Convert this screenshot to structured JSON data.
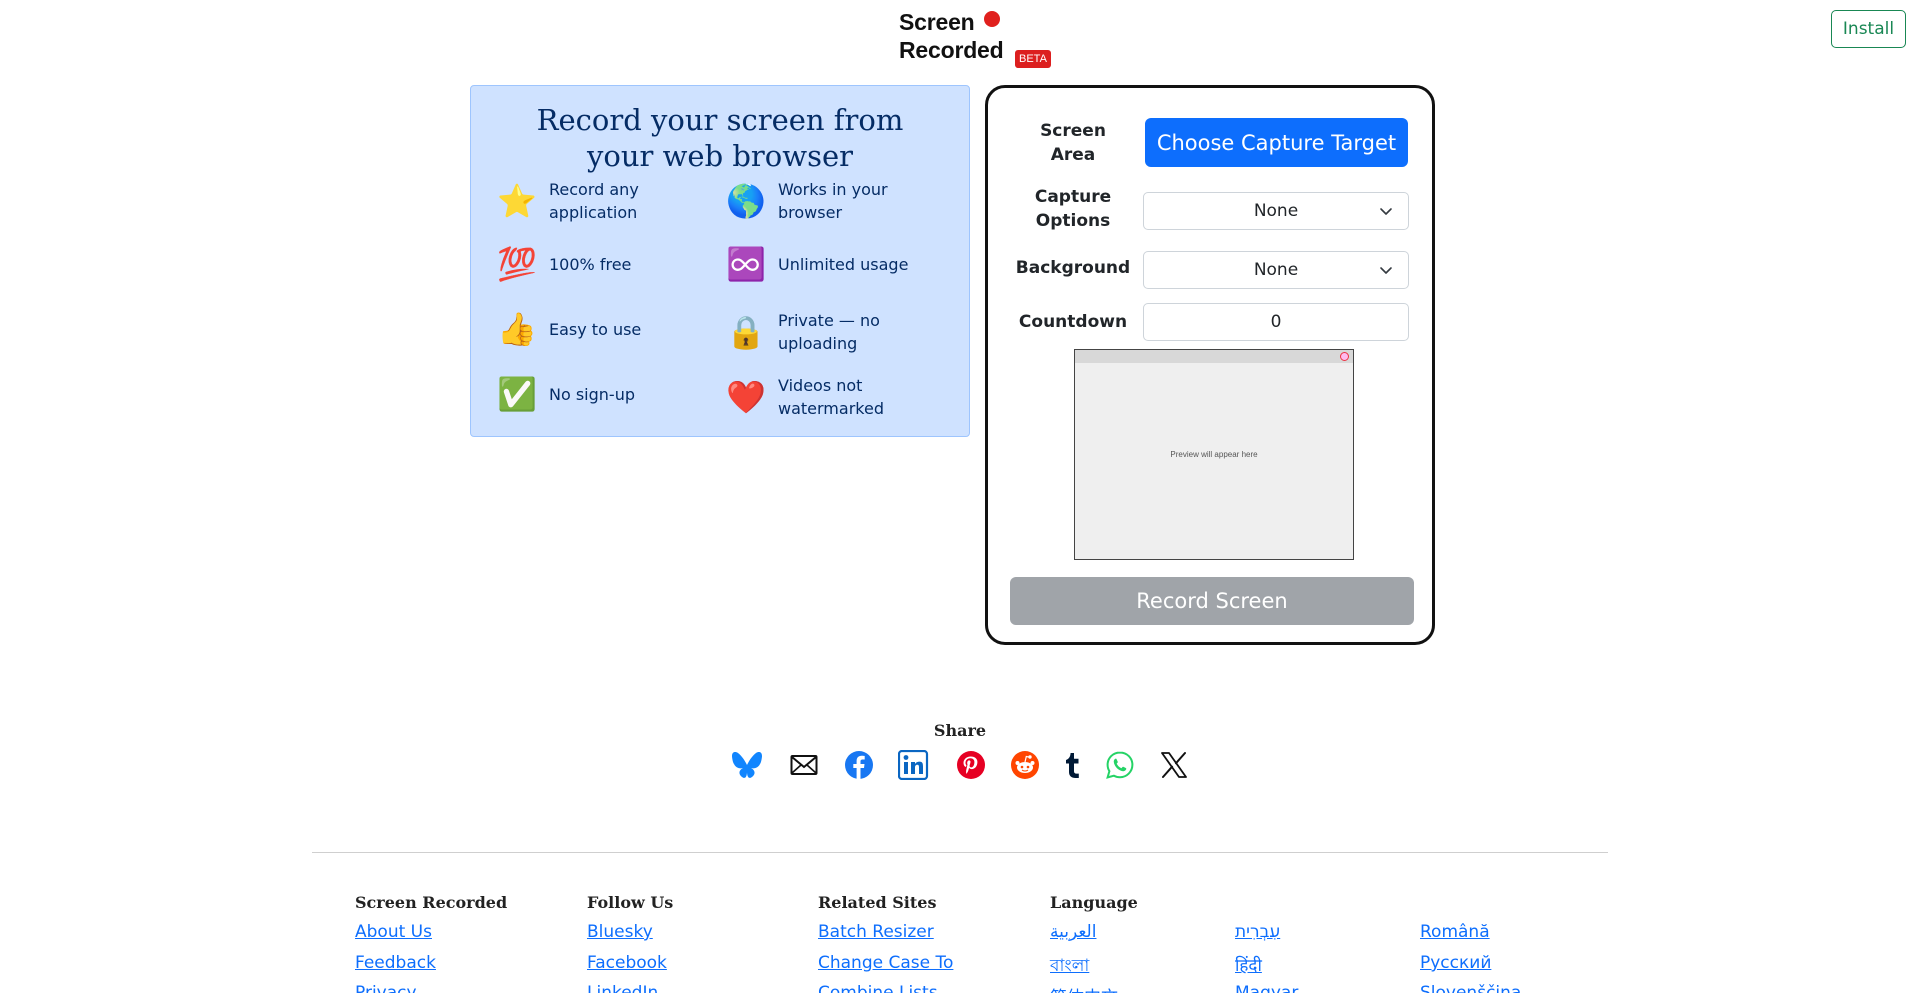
{
  "header": {
    "brand_line1": "Screen",
    "brand_line2": "Recorded",
    "beta": "BETA",
    "install_label": "Install"
  },
  "features": {
    "title": "Record your screen from your web browser",
    "items": [
      {
        "icon": "star-icon",
        "glyph": "⭐",
        "label": "Record any application"
      },
      {
        "icon": "globe-icon",
        "glyph": "🌎",
        "label": "Works in your browser"
      },
      {
        "icon": "hundred-icon",
        "glyph": "💯",
        "label": "100% free"
      },
      {
        "icon": "infinity-icon",
        "glyph": "♾️",
        "label": "Unlimited usage"
      },
      {
        "icon": "thumbs-up-icon",
        "glyph": "👍",
        "label": "Easy to use"
      },
      {
        "icon": "lock-icon",
        "glyph": "🔒",
        "label": "Private — no uploading"
      },
      {
        "icon": "check-icon",
        "glyph": "✅",
        "label": "No sign-up"
      },
      {
        "icon": "heart-icon",
        "glyph": "❤️",
        "label": "Videos not watermarked"
      }
    ]
  },
  "capture": {
    "screen_area_label": "Screen Area",
    "choose_target_label": "Choose Capture Target",
    "capture_options_label": "Capture Options",
    "capture_options_value": "None",
    "background_label": "Background",
    "background_value": "None",
    "countdown_label": "Countdown",
    "countdown_value": "0",
    "preview_text": "Preview will appear here",
    "record_label": "Record Screen"
  },
  "share": {
    "label": "Share",
    "icons": [
      "bluesky-icon",
      "email-icon",
      "facebook-icon",
      "linkedin-icon",
      "pinterest-icon",
      "reddit-icon",
      "tumblr-icon",
      "whatsapp-icon",
      "x-icon"
    ]
  },
  "footer": {
    "columns": [
      {
        "title": "Screen Recorded",
        "links": [
          "About Us",
          "Feedback",
          "Privacy"
        ]
      },
      {
        "title": "Follow Us",
        "links": [
          "Bluesky",
          "Facebook",
          "LinkedIn"
        ]
      },
      {
        "title": "Related Sites",
        "links": [
          "Batch Resizer",
          "Change Case To",
          "Combine Lists"
        ]
      },
      {
        "title": "Language",
        "links": [
          "العربية",
          "বাংলা",
          "简体中文"
        ]
      },
      {
        "title": "",
        "links": [
          "עִבְרִית",
          "हिंदी",
          "Magyar"
        ]
      },
      {
        "title": "",
        "links": [
          "Română",
          "Русский",
          "Slovenščina"
        ]
      }
    ]
  },
  "colors": {
    "primary": "#0d6efd",
    "feature_bg": "#cfe2ff",
    "beta_red": "#dc1f1f",
    "install_green": "#198754",
    "record_disabled": "#a0a4a9"
  }
}
